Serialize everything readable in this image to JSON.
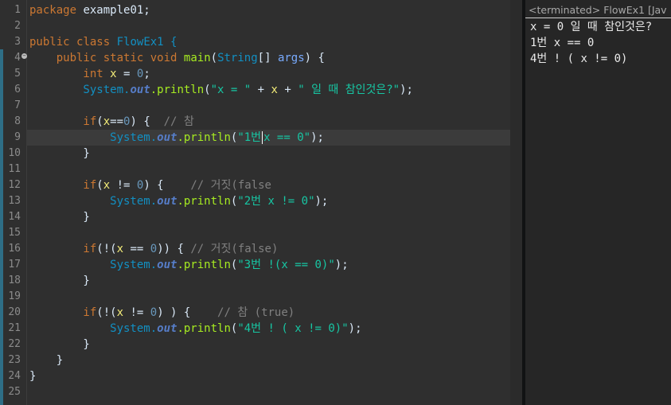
{
  "editor": {
    "line_numbers": [
      "1",
      "2",
      "3",
      "4",
      "5",
      "6",
      "7",
      "8",
      "9",
      "10",
      "11",
      "12",
      "13",
      "14",
      "15",
      "16",
      "17",
      "18",
      "19",
      "20",
      "21",
      "22",
      "23",
      "24",
      "25"
    ],
    "code": {
      "l1": {
        "t1": "package",
        "t2": " example01;"
      },
      "l3": {
        "t1": "public",
        "t2": " ",
        "t3": "class",
        "t4": " FlowEx1 {"
      },
      "l4": {
        "t1": "    public",
        "t2": " ",
        "t3": "static",
        "t4": " ",
        "t5": "void",
        "t6": " ",
        "t7": "main",
        "t8": "(",
        "t9": "String",
        "t10": "[] ",
        "t11": "args",
        "t12": ") {"
      },
      "l5": {
        "t1": "        int",
        "t2": " ",
        "t3": "x",
        "t4": " = ",
        "t5": "0",
        "t6": ";"
      },
      "l6": {
        "t1": "        System.",
        "t2": "out",
        "t3": ".println",
        "t4": "(",
        "t5": "\"x = \"",
        "t6": " + ",
        "t7": "x",
        "t8": " + ",
        "t9": "\" 일 때 참인것은?\"",
        "t10": ");"
      },
      "l8": {
        "t1": "        if",
        "t2": "(",
        "t3": "x",
        "t4": "==",
        "t5": "0",
        "t6": ") {  ",
        "t7": "// 참"
      },
      "l9": {
        "t1": "            System.",
        "t2": "out",
        "t3": ".println",
        "t4": "(",
        "t5": "\"1번",
        "t6": "x == 0\"",
        "t7": ");"
      },
      "l10": {
        "t1": "        }"
      },
      "l12": {
        "t1": "        if",
        "t2": "(",
        "t3": "x",
        "t4": " != ",
        "t5": "0",
        "t6": ") {    ",
        "t7": "// 거짓(false"
      },
      "l13": {
        "t1": "            System.",
        "t2": "out",
        "t3": ".println",
        "t4": "(",
        "t5": "\"2번 x != 0\"",
        "t6": ");"
      },
      "l14": {
        "t1": "        }"
      },
      "l16": {
        "t1": "        if",
        "t2": "(!(",
        "t3": "x",
        "t4": " == ",
        "t5": "0",
        "t6": ")) { ",
        "t7": "// 거짓(false)"
      },
      "l17": {
        "t1": "            System.",
        "t2": "out",
        "t3": ".println",
        "t4": "(",
        "t5": "\"3번 !(x == 0)\"",
        "t6": ");"
      },
      "l18": {
        "t1": "        }"
      },
      "l20": {
        "t1": "        if",
        "t2": "(!(",
        "t3": "x",
        "t4": " != ",
        "t5": "0",
        "t6": ") ) {    ",
        "t7": "// 참 (true)"
      },
      "l21": {
        "t1": "            System.",
        "t2": "out",
        "t3": ".println",
        "t4": "(",
        "t5": "\"4번 ! ( x != 0)\"",
        "t6": ");"
      },
      "l22": {
        "t1": "        }"
      },
      "l23": {
        "t1": "    }"
      },
      "l24": {
        "t1": "}"
      }
    }
  },
  "console": {
    "header": "<terminated> FlowEx1 [Jav",
    "lines": [
      "x = 0 일 때 참인것은?",
      "1번 x == 0",
      "4번 ! ( x != 0)"
    ]
  },
  "colors": {
    "keyword": "#cc7832",
    "class_name": "#1290c3",
    "method_decl": "#a7ec21",
    "local_var": "#f3ec79",
    "parameter": "#79abff",
    "static_field": "#567dc8",
    "string": "#17c6a3",
    "number": "#6897bb",
    "comment": "#808080",
    "editor_bg": "#2f2f2f",
    "console_bg": "#262626"
  },
  "icons": {
    "fold": "fold-collapse-icon"
  }
}
